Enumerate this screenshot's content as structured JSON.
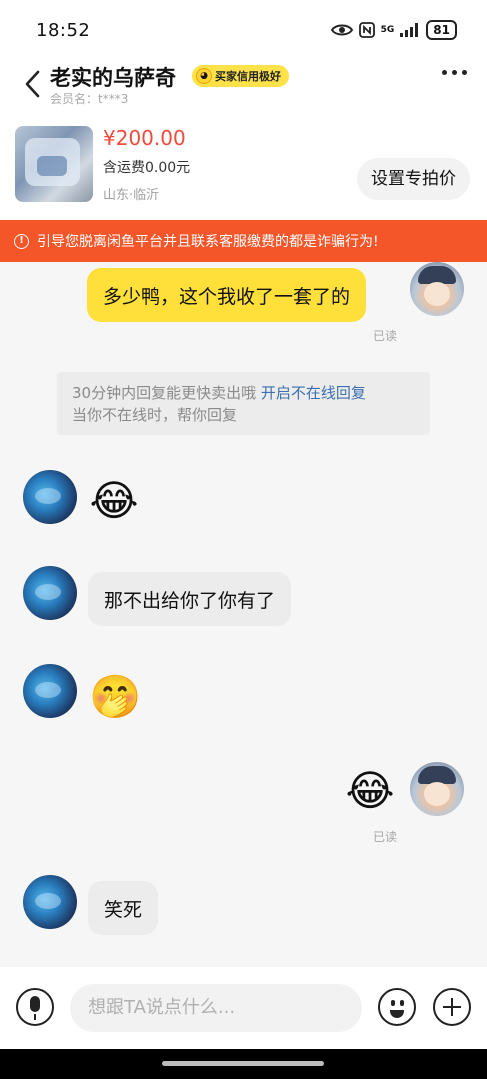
{
  "status_bar": {
    "time": "18:52",
    "signal_label": "5G",
    "battery": "81"
  },
  "header": {
    "title": "老实的乌萨奇",
    "badge_label": "买家信用极好",
    "member_label": "会员名：t***3"
  },
  "product": {
    "price": "¥200.00",
    "shipping": "含运费0.00元",
    "location": "山东·临沂",
    "special_price_button": "设置专拍价"
  },
  "warning": {
    "text": "引导您脱离闲鱼平台并且联系客服缴费的都是诈骗行为!"
  },
  "messages": [
    {
      "side": "mine",
      "type": "text",
      "text": "多少鸭，这个我收了一套了的",
      "read": "已读"
    },
    {
      "side": "system",
      "type": "tip",
      "text": "30分钟内回复能更快卖出哦",
      "link": "开启不在线回复",
      "text2": "当你不在线时，帮你回复"
    },
    {
      "side": "theirs",
      "type": "emoji",
      "emoji": "😂"
    },
    {
      "side": "theirs",
      "type": "text",
      "text": "那不出给你了你有了"
    },
    {
      "side": "theirs",
      "type": "emoji",
      "emoji": "🤭"
    },
    {
      "side": "mine",
      "type": "emoji",
      "emoji": "😂",
      "read": "已读"
    },
    {
      "side": "theirs",
      "type": "text",
      "text": "笑死"
    }
  ],
  "input_bar": {
    "placeholder": "想跟TA说点什么..."
  },
  "icons": {
    "back": "chevron-left-icon",
    "more": "more-dots-icon",
    "voice": "microphone-icon",
    "emoji": "smile-icon",
    "add": "plus-icon"
  },
  "colors": {
    "accent_yellow": "#ffe03a",
    "price_red": "#f04a3a",
    "warning_orange": "#f4562a",
    "link_blue": "#3c6fb0"
  }
}
